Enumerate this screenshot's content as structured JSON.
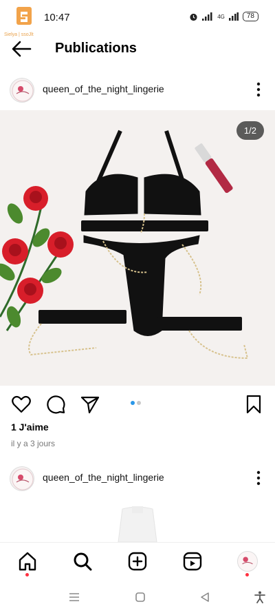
{
  "status_bar": {
    "time": "10:47",
    "network": "4G",
    "battery": "78",
    "logo_text": "Sielya | ssoJlt"
  },
  "header": {
    "title": "Publications"
  },
  "posts": [
    {
      "username": "queen_of_the_night_lingerie",
      "page_indicator": "1/2",
      "likes": "1 J'aime",
      "time_ago": "il y a 3 jours"
    },
    {
      "username": "queen_of_the_night_lingerie"
    }
  ],
  "icons": {
    "back": "arrow-left-icon",
    "more": "more-vertical-icon",
    "like": "heart-icon",
    "comment": "comment-icon",
    "share": "send-icon",
    "save": "bookmark-icon",
    "nav": [
      "home-icon",
      "search-icon",
      "create-icon",
      "reels-icon",
      "profile-icon"
    ],
    "system": [
      "menu-icon",
      "home-square-icon",
      "back-triangle-icon",
      "accessibility-icon"
    ]
  },
  "colors": {
    "accent_blue": "#2a97e8",
    "notification_red": "#ff3040"
  }
}
